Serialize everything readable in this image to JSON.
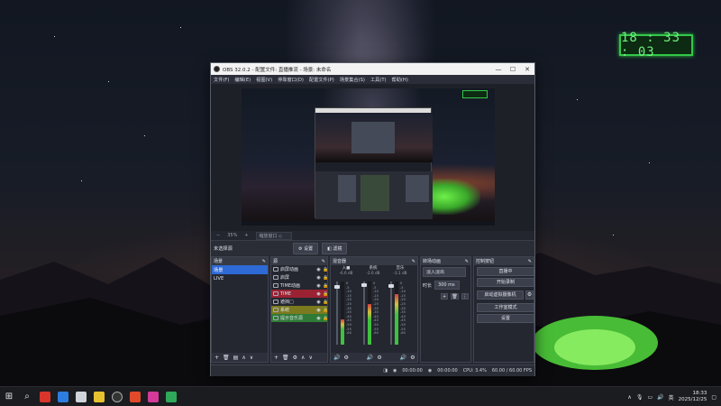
{
  "desktop_clock": "18 : 33 : 03",
  "obs": {
    "title": "OBS 32.0.2 - 配置文件: 直播推流 - 场景: 未命名",
    "menu": [
      "文件(F)",
      "编辑(E)",
      "视图(V)",
      "停靠窗口(D)",
      "配置文件(P)",
      "场景集合(S)",
      "工具(T)",
      "帮助(H)"
    ],
    "zoom": "35%",
    "zoom_mode": "缩放窗口 ◇",
    "source_bar": {
      "no_source": "未选择源",
      "settings": "设置",
      "filters": "滤镜"
    },
    "docks": {
      "scenes": {
        "title": "场景",
        "items": [
          "场景",
          "LIVE"
        ]
      },
      "sources": {
        "title": "源",
        "items": [
          {
            "name": "启屏动画",
            "style": "normal"
          },
          {
            "name": "启屏",
            "style": "normal"
          },
          {
            "name": "TIME动画",
            "style": "normal"
          },
          {
            "name": "TIME",
            "style": "red"
          },
          {
            "name": "遮挡□",
            "style": "normal"
          },
          {
            "name": "系统",
            "style": "yellow"
          },
          {
            "name": "提示音乐源",
            "style": "green"
          }
        ]
      },
      "mixer": {
        "title": "混音器",
        "channels": [
          {
            "name": "入■",
            "db": "-6.6 dB"
          },
          {
            "name": "系统",
            "db": "-2.6 dB"
          },
          {
            "name": "音乐",
            "db": "-3.1 dB"
          }
        ],
        "scale": [
          "0",
          "-5",
          "-10",
          "-15",
          "-20",
          "-25",
          "-30",
          "-35",
          "-40",
          "-45",
          "-50",
          "-55",
          "-60"
        ]
      },
      "transitions": {
        "title": "转场动画",
        "type": "淡入淡出",
        "duration_label": "时长",
        "duration": "300 ms"
      },
      "controls": {
        "title": "控制按钮",
        "buttons": [
          "直播中",
          "开始录制",
          "启动虚拟摄像机",
          "工作室模式",
          "设置"
        ]
      }
    },
    "status": {
      "stream_time": "00:00:00",
      "rec_time": "00:00:00",
      "cpu": "CPU: 3.4%",
      "fps": "60.00 / 60.00 FPS"
    }
  },
  "taskbar": {
    "lang": "英",
    "time": "18:33",
    "date": "2025/12/25"
  },
  "icons": {
    "close": "✕",
    "maximize": "☐",
    "minimize": "—",
    "gear": "⚙",
    "dock_float": "✎"
  }
}
